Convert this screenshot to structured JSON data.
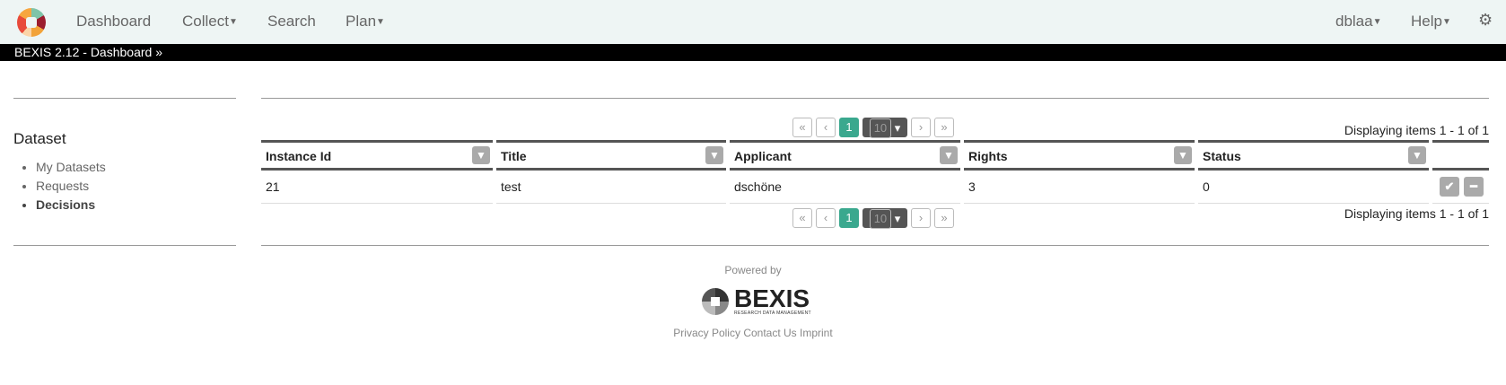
{
  "nav": {
    "items": [
      "Dashboard",
      "Collect",
      "Search",
      "Plan"
    ],
    "user": "dblaa",
    "help": "Help"
  },
  "breadcrumb": "BEXIS 2.12 - Dashboard",
  "sidebar": {
    "title": "Dataset",
    "items": [
      "My Datasets",
      "Requests",
      "Decisions"
    ]
  },
  "pager": {
    "first": "«",
    "prev": "‹",
    "page": "1",
    "size": "10",
    "next": "›",
    "last": "»",
    "display": "Displaying items 1 - 1 of 1"
  },
  "table": {
    "headers": [
      "Instance Id",
      "Title",
      "Applicant",
      "Rights",
      "Status"
    ],
    "rows": [
      [
        "21",
        "test",
        "dschöne",
        "3",
        "0"
      ]
    ]
  },
  "footer": {
    "powered": "Powered by",
    "logo": "BEXIS",
    "logo_sub": "RESEARCH DATA MANAGEMENT",
    "links": [
      "Privacy Policy",
      "Contact Us",
      "Imprint"
    ]
  },
  "colors": {
    "accent": "#3aa88e",
    "nav_bg": "#eef5f4"
  }
}
